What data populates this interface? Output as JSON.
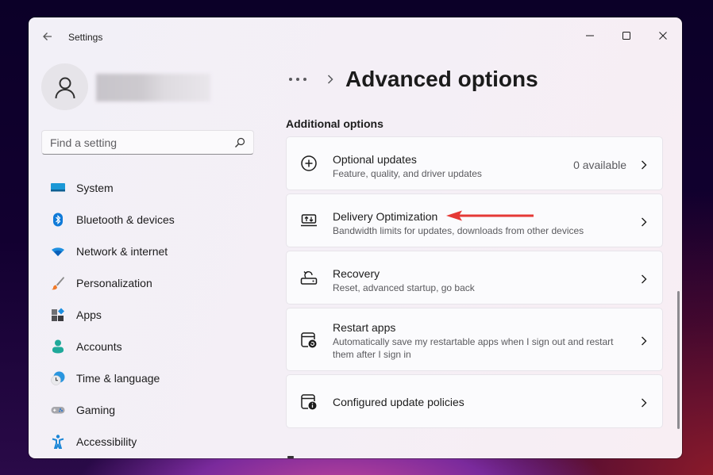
{
  "window": {
    "app_title": "Settings",
    "controls": {
      "minimize": "minimize",
      "maximize": "maximize",
      "close": "close"
    }
  },
  "user": {
    "name_blurred": true
  },
  "search": {
    "placeholder": "Find a setting",
    "value": ""
  },
  "sidebar": {
    "items": [
      {
        "label": "System",
        "icon": "system-icon"
      },
      {
        "label": "Bluetooth & devices",
        "icon": "bluetooth-icon"
      },
      {
        "label": "Network & internet",
        "icon": "wifi-icon"
      },
      {
        "label": "Personalization",
        "icon": "brush-icon"
      },
      {
        "label": "Apps",
        "icon": "apps-icon"
      },
      {
        "label": "Accounts",
        "icon": "accounts-icon"
      },
      {
        "label": "Time & language",
        "icon": "time-language-icon"
      },
      {
        "label": "Gaming",
        "icon": "gaming-icon"
      },
      {
        "label": "Accessibility",
        "icon": "accessibility-icon"
      }
    ]
  },
  "header": {
    "breadcrumb_more": "...",
    "title": "Advanced options"
  },
  "section": {
    "title": "Additional options",
    "cards": [
      {
        "title": "Optional updates",
        "subtitle": "Feature, quality, and driver updates",
        "value": "0 available",
        "icon": "plus-circle-icon"
      },
      {
        "title": "Delivery Optimization",
        "subtitle": "Bandwidth limits for updates, downloads from other devices",
        "value": "",
        "icon": "delivery-optimization-icon"
      },
      {
        "title": "Recovery",
        "subtitle": "Reset, advanced startup, go back",
        "value": "",
        "icon": "recovery-icon"
      },
      {
        "title": "Restart apps",
        "subtitle": "Automatically save my restartable apps when I sign out and restart them after I sign in",
        "value": "",
        "icon": "restart-apps-icon"
      },
      {
        "title": "Configured update policies",
        "subtitle": "",
        "value": "",
        "icon": "update-policies-icon"
      }
    ]
  },
  "annotation": {
    "arrow_color": "#e53935",
    "points_to": "Delivery Optimization"
  },
  "colors": {
    "accent_blue": "#0f7ad8",
    "accent_teal": "#1fa99a",
    "text_primary": "#1c1c1c",
    "text_secondary": "#5a5a5e"
  }
}
